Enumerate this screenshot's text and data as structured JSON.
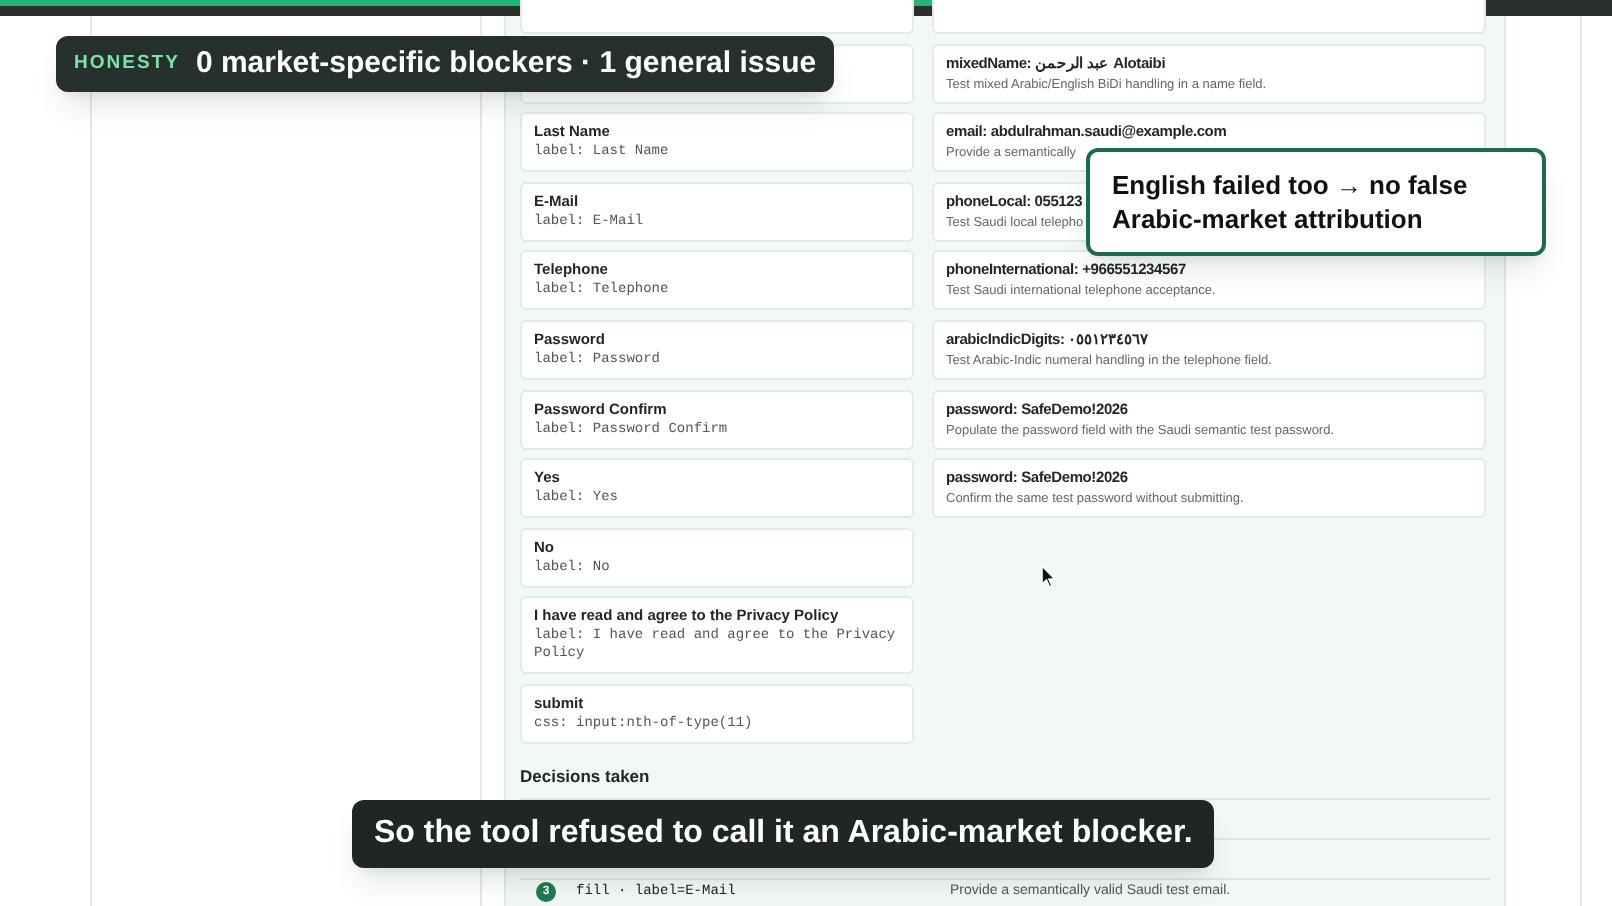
{
  "honesty_banner": {
    "tag": "HONESTY",
    "text": "0 market-specific blockers · 1 general issue"
  },
  "targets": [
    {
      "title": "Last Name",
      "locator": "label: Last Name"
    },
    {
      "title": "E-Mail",
      "locator": "label: E-Mail"
    },
    {
      "title": "Telephone",
      "locator": "label: Telephone"
    },
    {
      "title": "Password",
      "locator": "label: Password"
    },
    {
      "title": "Password Confirm",
      "locator": "label: Password Confirm"
    },
    {
      "title": "Yes",
      "locator": "label: Yes"
    },
    {
      "title": "No",
      "locator": "label: No"
    },
    {
      "title": "I have read and agree to the Privacy Policy",
      "locator": "label: I have read and agree to the Privacy Policy"
    },
    {
      "title": "submit",
      "locator": "css: input:nth-of-type(11)"
    }
  ],
  "test_values": [
    {
      "title": "mixedName: عبد الرحمن Alotaibi",
      "detail": "Test mixed Arabic/English BiDi handling in a name field."
    },
    {
      "title": "email: abdulrahman.saudi@example.com",
      "detail": "Provide a semantically"
    },
    {
      "title": "phoneLocal: 055123",
      "detail": "Test Saudi local telepho"
    },
    {
      "title": "phoneInternational: +966551234567",
      "detail": "Test Saudi international telephone acceptance."
    },
    {
      "title": "arabicIndicDigits: ٠٥٥١٢٣٤٥٦٧",
      "detail": "Test Arabic-Indic numeral handling in the telephone field."
    },
    {
      "title": "password: SafeDemo!2026",
      "detail": "Populate the password field with the Saudi semantic test password."
    },
    {
      "title": "password: SafeDemo!2026",
      "detail": "Confirm the same test password without submitting."
    }
  ],
  "decisions": {
    "heading": "Decisions taken",
    "rows": [
      {
        "number": "3",
        "action": "fill · label=E-Mail",
        "note": "Provide a semantically valid Saudi test email."
      }
    ]
  },
  "callout": {
    "text": "English failed too → no false Arabic-market attribution"
  },
  "subtitle": {
    "text": "So the tool refused to call it an Arabic-market blocker."
  }
}
